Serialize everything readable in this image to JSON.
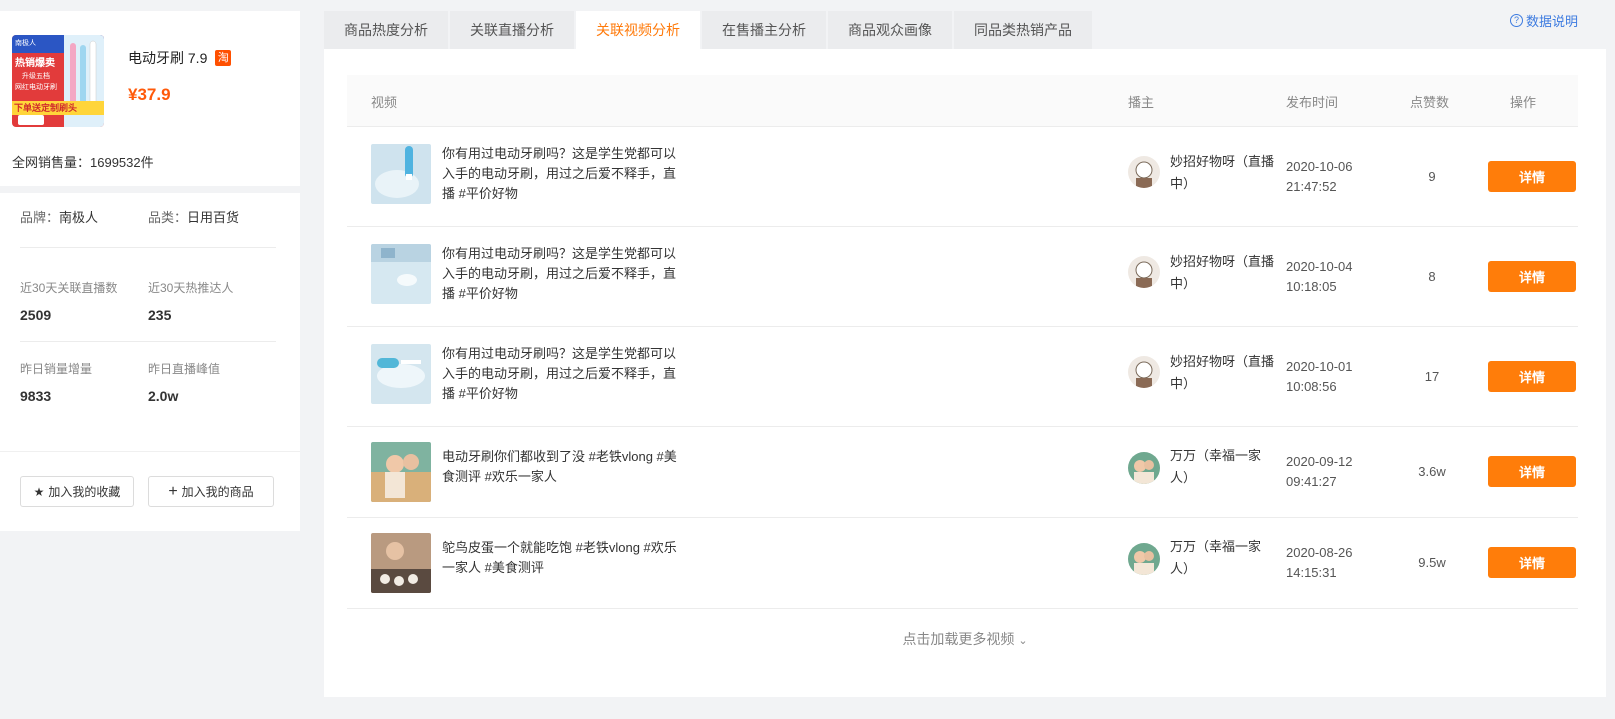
{
  "product": {
    "name": "电动牙刷 7.9",
    "platform_badge": "淘",
    "price": "¥37.9",
    "total_sales": "全网销售量：1699532件",
    "image_texts": [
      "南极人",
      "热销爆卖",
      "升级五档",
      "网红电动牙刷",
      "下单送定制刷头"
    ],
    "brand_label": "品牌：",
    "brand": "南极人",
    "category_label": "品类：",
    "category": "日用百货",
    "stats": [
      {
        "label": "近30天关联直播数",
        "value": "2509"
      },
      {
        "label": "近30天热推达人",
        "value": "235"
      },
      {
        "label": "昨日销量增量",
        "value": "9833"
      },
      {
        "label": "昨日直播峰值",
        "value": "2.0w"
      }
    ],
    "fav_button": "加入我的收藏",
    "add_button": "加入我的商品"
  },
  "tabs": [
    {
      "label": "商品热度分析"
    },
    {
      "label": "关联直播分析"
    },
    {
      "label": "关联视频分析",
      "active": true
    },
    {
      "label": "在售播主分析"
    },
    {
      "label": "商品观众画像"
    },
    {
      "label": "同品类热销产品"
    }
  ],
  "help_link": "数据说明",
  "table": {
    "columns": [
      "视频",
      "播主",
      "发布时间",
      "点赞数",
      "操作"
    ],
    "rows": [
      {
        "title": "你有用过电动牙刷吗？这是学生党都可以入手的电动牙刷，用过之后爱不释手，直播 #平价好物",
        "host": "妙招好物呀（直播中）",
        "date": "2020-10-06",
        "time": "21:47:52",
        "likes": "9",
        "action": "详情"
      },
      {
        "title": "你有用过电动牙刷吗？这是学生党都可以入手的电动牙刷，用过之后爱不释手，直播 #平价好物",
        "host": "妙招好物呀（直播中）",
        "date": "2020-10-04",
        "time": "10:18:05",
        "likes": "8",
        "action": "详情"
      },
      {
        "title": "你有用过电动牙刷吗？这是学生党都可以入手的电动牙刷，用过之后爱不释手，直播 #平价好物",
        "host": "妙招好物呀（直播中）",
        "date": "2020-10-01",
        "time": "10:08:56",
        "likes": "17",
        "action": "详情"
      },
      {
        "title": "电动牙刷你们都收到了没 #老铁vlong #美食测评 #欢乐一家人",
        "host": "万万（幸福一家人）",
        "date": "2020-09-12",
        "time": "09:41:27",
        "likes": "3.6w",
        "action": "详情"
      },
      {
        "title": "鸵鸟皮蛋一个就能吃饱 #老铁vlong #欢乐一家人 #美食测评",
        "host": "万万（幸福一家人）",
        "date": "2020-08-26",
        "time": "14:15:31",
        "likes": "9.5w",
        "action": "详情"
      }
    ]
  },
  "load_more": "点击加载更多视频",
  "colors": {
    "accent": "#ff7d0a",
    "price": "#ff5a0a",
    "link": "#3d7be0"
  }
}
